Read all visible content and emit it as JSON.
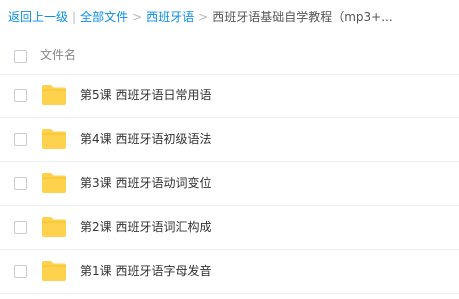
{
  "breadcrumb": {
    "back": "返回上一级",
    "all_files": "全部文件",
    "folder": "西班牙语",
    "current": "西班牙语基础自学教程（mp3+..."
  },
  "header": {
    "column_name": "文件名"
  },
  "files": [
    {
      "name": "第5课 西班牙语日常用语"
    },
    {
      "name": "第4课 西班牙语初级语法"
    },
    {
      "name": "第3课 西班牙语动词变位"
    },
    {
      "name": "第2课 西班牙语词汇构成"
    },
    {
      "name": "第1课 西班牙语字母发音"
    }
  ],
  "colors": {
    "link": "#0a8fe8",
    "folder": "#ffd24d"
  }
}
